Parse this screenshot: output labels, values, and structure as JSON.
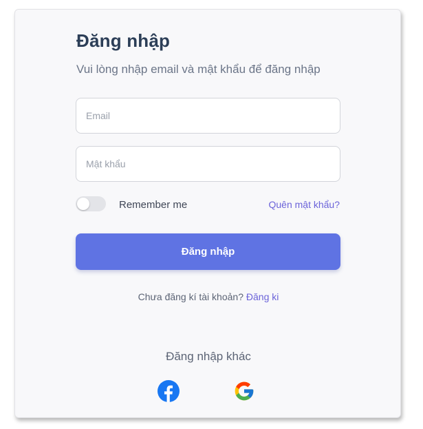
{
  "login": {
    "title": "Đăng nhập",
    "subtitle": "Vui lòng nhập email và mật khẩu để đăng nhập",
    "email_placeholder": "Email",
    "password_placeholder": "Mật khẩu",
    "remember_label": "Remember me",
    "remember_checked": false,
    "forgot_label": "Quên mật khẩu?",
    "submit_label": "Đăng nhập",
    "signup_prompt": "Chưa đăng kí tài khoản?",
    "signup_link": "Đăng ki",
    "other_title": "Đăng nhập khác"
  },
  "social": [
    {
      "icon": "facebook-icon"
    },
    {
      "icon": "google-icon"
    }
  ],
  "colors": {
    "accent": "#5f73e3",
    "link": "#6b63d9",
    "title": "#2c3e57",
    "facebook": "#1877f2"
  }
}
